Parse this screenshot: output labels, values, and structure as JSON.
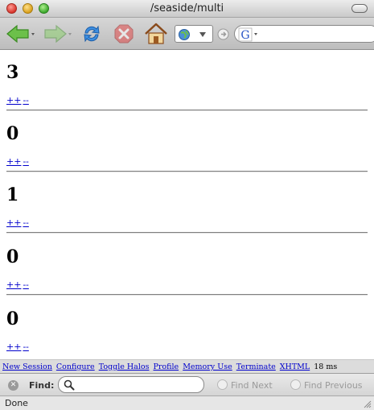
{
  "window": {
    "title": "/seaside/multi"
  },
  "toolbar": {
    "back_icon": "back-arrow-icon",
    "forward_icon": "forward-arrow-icon",
    "reload_icon": "reload-icon",
    "stop_icon": "stop-icon",
    "home_icon": "home-icon",
    "search_engine_letter": "G"
  },
  "counters": [
    {
      "value": "3",
      "increment_label": "++",
      "decrement_label": "--"
    },
    {
      "value": "0",
      "increment_label": "++",
      "decrement_label": "--"
    },
    {
      "value": "1",
      "increment_label": "++",
      "decrement_label": "--"
    },
    {
      "value": "0",
      "increment_label": "++",
      "decrement_label": "--"
    },
    {
      "value": "0",
      "increment_label": "++",
      "decrement_label": "--"
    }
  ],
  "seaside_toolbar": {
    "links": [
      "New Session",
      "Configure",
      "Toggle Halos",
      "Profile",
      "Memory Use",
      "Terminate",
      "XHTML"
    ],
    "timing": "18 ms"
  },
  "findbar": {
    "label": "Find:",
    "value": "",
    "next_label": "Find Next",
    "previous_label": "Find Previous"
  },
  "status": {
    "text": "Done"
  },
  "colors": {
    "link": "#0000cc",
    "toolbar_bg": "#c9c9c9",
    "dev_toolbar_bg": "#dcdcdc"
  }
}
